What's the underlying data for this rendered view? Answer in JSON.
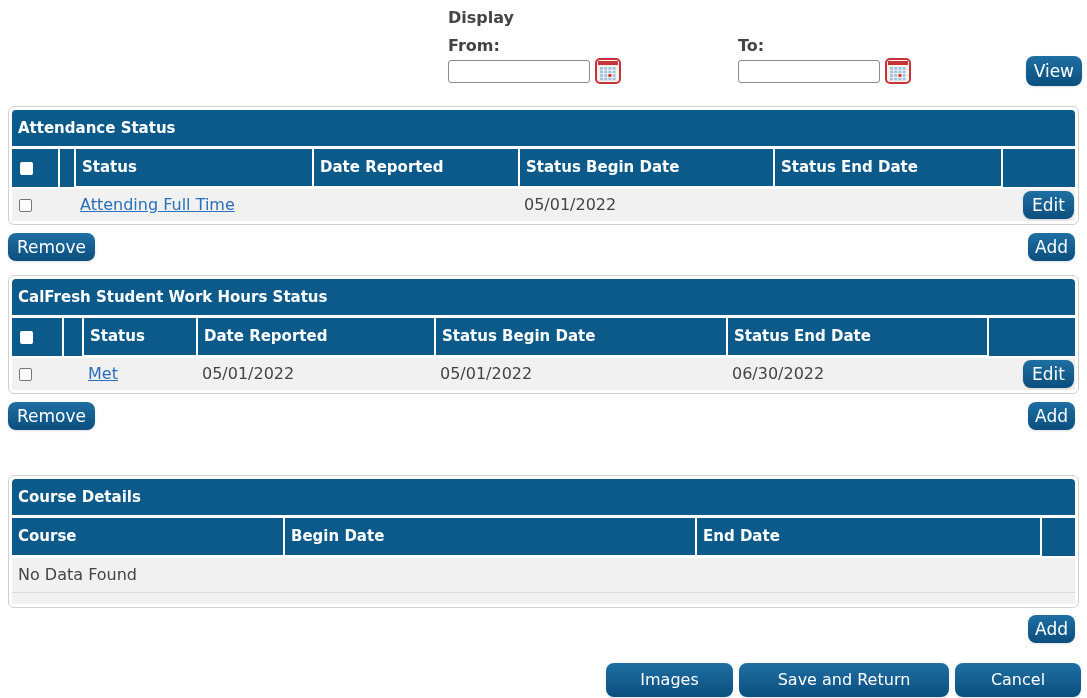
{
  "filter": {
    "title": "Display",
    "from_label": "From:",
    "to_label": "To:",
    "view_button": "View"
  },
  "sections": [
    {
      "title": "Attendance Status",
      "select_all": {
        "checked": false
      },
      "columns": [
        "Status",
        "Date Reported",
        "Status Begin Date",
        "Status End Date"
      ],
      "rows": [
        {
          "checked": false,
          "cells": [
            {
              "kind": "link",
              "text": "Attending Full Time"
            },
            null,
            {
              "kind": "text",
              "text": "05/01/2022"
            },
            null
          ],
          "button": "Edit"
        }
      ],
      "left_button": "Remove",
      "right_button": "Add"
    },
    {
      "title": "CalFresh Student Work Hours Status",
      "select_all": {
        "checked": false
      },
      "columns": [
        "Status",
        "Date Reported",
        "Status Begin Date",
        "Status End Date"
      ],
      "rows": [
        {
          "checked": false,
          "cells": [
            {
              "kind": "link",
              "text": "Met"
            },
            {
              "kind": "text",
              "text": "05/01/2022"
            },
            {
              "kind": "text",
              "text": "05/01/2022"
            },
            {
              "kind": "text",
              "text": "06/30/2022"
            }
          ],
          "button": "Edit"
        }
      ],
      "left_button": "Remove",
      "right_button": "Add"
    },
    {
      "title": "Course Details",
      "columns": [
        "Course",
        "Begin Date",
        "End Date"
      ],
      "empty_text": "No Data Found",
      "right_button": "Add"
    }
  ],
  "footer_buttons": [
    "Images",
    "Save and Return",
    "Cancel"
  ]
}
